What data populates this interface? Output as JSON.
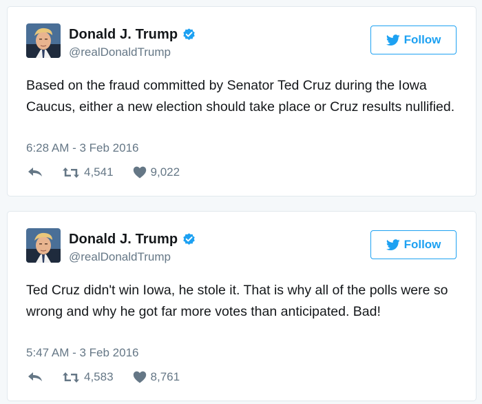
{
  "colors": {
    "accent": "#1da1f2",
    "text": "#14171a",
    "muted": "#657786",
    "border": "#e1e8ed",
    "background": "#f5f8fa"
  },
  "tweets": [
    {
      "display_name": "Donald J. Trump",
      "handle": "@realDonaldTrump",
      "verified_icon": "verified-badge-icon",
      "follow_label": "Follow",
      "text": "Based on the fraud committed by Senator Ted Cruz during the Iowa Caucus, either a new election should take place or Cruz results nullified.",
      "timestamp": "6:28 AM - 3 Feb 2016",
      "retweets": "4,541",
      "likes": "9,022"
    },
    {
      "display_name": "Donald J. Trump",
      "handle": "@realDonaldTrump",
      "verified_icon": "verified-badge-icon",
      "follow_label": "Follow",
      "text": "Ted Cruz didn't win Iowa, he stole it. That is why all of the polls were so wrong and why he got far more votes than anticipated. Bad!",
      "timestamp": "5:47 AM - 3 Feb 2016",
      "retweets": "4,583",
      "likes": "8,761"
    }
  ]
}
